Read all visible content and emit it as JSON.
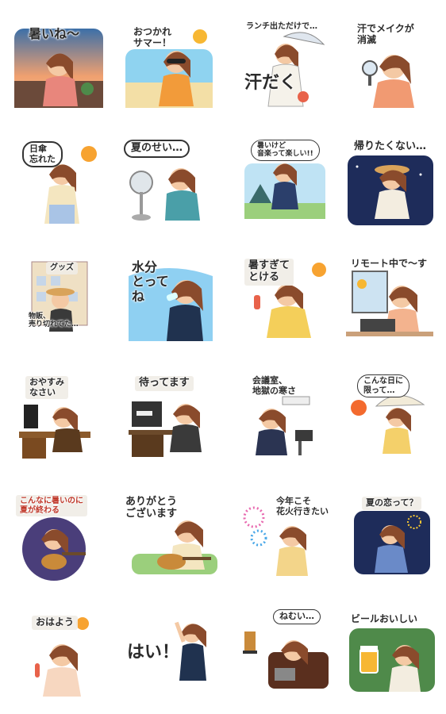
{
  "stickers": [
    {
      "id": "s1",
      "caption": "暑いね～",
      "icon": "girl-sunset-balcony"
    },
    {
      "id": "s2",
      "caption": "おつかれ\nサマー！",
      "icon": "girl-sunglasses-beach"
    },
    {
      "id": "s3",
      "caption_top": "ランチ出ただけで…",
      "caption_bottom": "汗だく",
      "icon": "girl-umbrella-sweat"
    },
    {
      "id": "s4",
      "caption": "汗でメイクが\n消滅",
      "icon": "girl-mirror"
    },
    {
      "id": "s5",
      "caption": "日傘\n忘れた",
      "icon": "girl-sun-forgot-parasol"
    },
    {
      "id": "s6",
      "caption": "夏のせい…",
      "icon": "girl-electric-fan"
    },
    {
      "id": "s7",
      "caption": "暑いけど\n音楽って楽しい!!",
      "icon": "girl-jumping-festival"
    },
    {
      "id": "s8",
      "caption": "帰りたくない…",
      "icon": "girl-night-sitting"
    },
    {
      "id": "s9",
      "caption_top": "グッズ",
      "caption_bottom": "物販、\n売り切れてた…",
      "icon": "girl-merch-board"
    },
    {
      "id": "s10",
      "caption": "水分\nとって\nね",
      "icon": "girl-drinking-water"
    },
    {
      "id": "s11",
      "caption": "暑すぎて\nとける",
      "icon": "girl-melting-popsicle"
    },
    {
      "id": "s12",
      "caption": "リモート中で～す",
      "icon": "girl-laptop-remote"
    },
    {
      "id": "s13",
      "caption": "おやすみ\nなさい",
      "icon": "girl-sleeping-desk-moon"
    },
    {
      "id": "s14",
      "caption": "待ってます",
      "icon": "girl-waiting-office"
    },
    {
      "id": "s15",
      "caption": "会議室、\n地獄の寒さ",
      "icon": "girl-cold-aircon"
    },
    {
      "id": "s16",
      "caption": "こんな日に\n限って…",
      "icon": "girl-parasol-sun"
    },
    {
      "id": "s17",
      "caption": "こんなに暑いのに\n夏が終わる",
      "icon": "girl-guitar-moon"
    },
    {
      "id": "s18",
      "caption": "ありがとう\nございます",
      "icon": "girl-guitar-grass"
    },
    {
      "id": "s19",
      "caption": "今年こそ\n花火行きたい",
      "icon": "girl-yukata-fireworks"
    },
    {
      "id": "s20",
      "caption": "夏の恋って？",
      "icon": "girl-yukata-night"
    },
    {
      "id": "s21",
      "caption": "おはよう",
      "icon": "girl-morning-sun"
    },
    {
      "id": "s22",
      "caption": "はい！",
      "icon": "girl-raising-hand"
    },
    {
      "id": "s23",
      "caption": "ねむい…",
      "icon": "girl-sofa-laptop"
    },
    {
      "id": "s24",
      "caption": "ビールおいしい",
      "icon": "girl-beer-garden"
    }
  ]
}
